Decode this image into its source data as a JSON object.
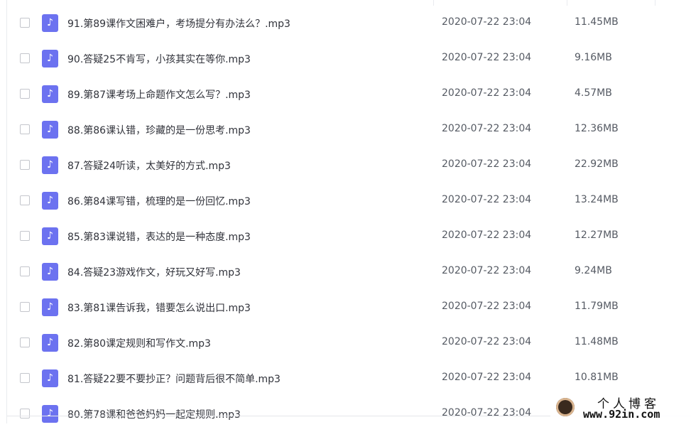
{
  "files": [
    {
      "name": "91.第89课作文困难户，考场提分有办法么？.mp3",
      "date": "2020-07-22 23:04",
      "size": "11.45MB"
    },
    {
      "name": "90.答疑25不肯写，小孩其实在等你.mp3",
      "date": "2020-07-22 23:04",
      "size": "9.16MB"
    },
    {
      "name": "89.第87课考场上命题作文怎么写？.mp3",
      "date": "2020-07-22 23:04",
      "size": "4.57MB"
    },
    {
      "name": "88.第86课认错，珍藏的是一份思考.mp3",
      "date": "2020-07-22 23:04",
      "size": "12.36MB"
    },
    {
      "name": "87.答疑24听读，太美好的方式.mp3",
      "date": "2020-07-22 23:04",
      "size": "22.92MB"
    },
    {
      "name": "86.第84课写错，梳理的是一份回忆.mp3",
      "date": "2020-07-22 23:04",
      "size": "13.24MB"
    },
    {
      "name": "85.第83课说错，表达的是一种态度.mp3",
      "date": "2020-07-22 23:04",
      "size": "12.27MB"
    },
    {
      "name": "84.答疑23游戏作文，好玩又好写.mp3",
      "date": "2020-07-22 23:04",
      "size": "9.24MB"
    },
    {
      "name": "83.第81课告诉我，错要怎么说出口.mp3",
      "date": "2020-07-22 23:04",
      "size": "11.79MB"
    },
    {
      "name": "82.第80课定规则和写作文.mp3",
      "date": "2020-07-22 23:04",
      "size": "11.48MB"
    },
    {
      "name": "81.答疑22要不要抄正？问题背后很不简单.mp3",
      "date": "2020-07-22 23:04",
      "size": "10.81MB"
    },
    {
      "name": "80.第78课和爸爸妈妈一起定规则.mp3",
      "date": "2020-07-22 23:04",
      "size": ""
    }
  ],
  "file_icon": "music-note-icon",
  "accent_color": "#6c72f0",
  "watermark": {
    "title": "个人博客",
    "url": "www.92in.com"
  }
}
